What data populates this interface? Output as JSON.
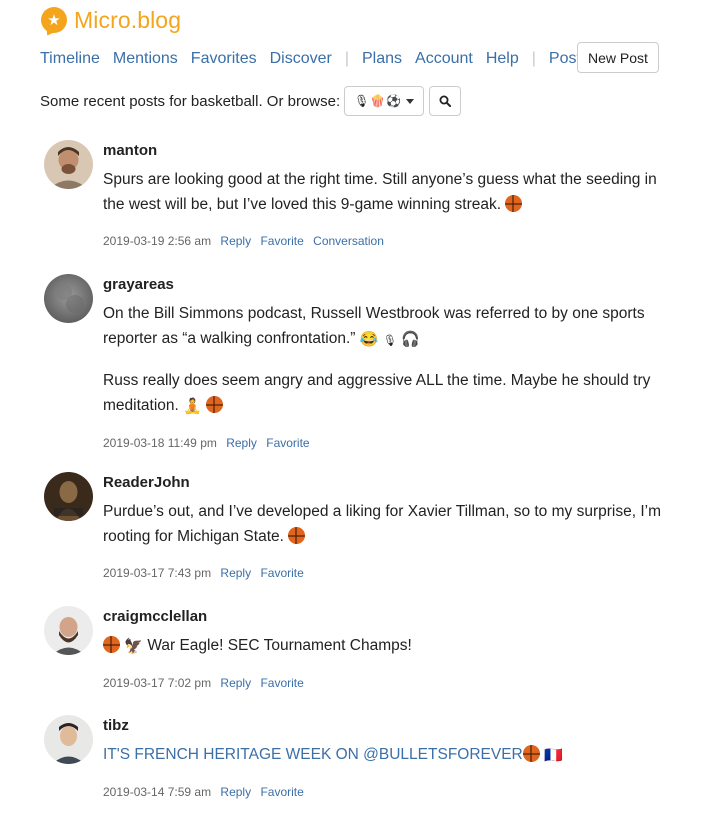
{
  "app": {
    "name": "Micro.blog"
  },
  "nav": {
    "items": [
      "Timeline",
      "Mentions",
      "Favorites",
      "Discover",
      "Plans",
      "Account",
      "Help",
      "Posts"
    ],
    "new_post": "New Post"
  },
  "browse": {
    "text": "Some recent posts for basketball. Or browse:",
    "dropdown_emojis": [
      "🎙",
      "🍿",
      "⚽"
    ]
  },
  "posts": [
    {
      "username": "manton",
      "paragraphs": [
        "Spurs are looking good at the right time. Still anyone’s guess what the seeding in the west will be, but I’ve loved this 9-game winning streak."
      ],
      "date": "2019-03-19 2:56 am",
      "actions": [
        "Reply",
        "Favorite",
        "Conversation"
      ]
    },
    {
      "username": "grayareas",
      "paragraphs": [
        "On the Bill Simmons podcast, Russell Westbrook was referred to by one sports reporter as “a walking confrontation.”",
        "Russ really does seem angry and aggressive ALL the time. Maybe he should try meditation."
      ],
      "date": "2019-03-18 11:49 pm",
      "actions": [
        "Reply",
        "Favorite"
      ]
    },
    {
      "username": "ReaderJohn",
      "paragraphs": [
        "Purdue’s out, and I’ve developed a liking for Xavier Tillman, so to my surprise, I’m rooting for Michigan State."
      ],
      "date": "2019-03-17 7:43 pm",
      "actions": [
        "Reply",
        "Favorite"
      ]
    },
    {
      "username": "craigmcclellan",
      "paragraphs": [
        "War Eagle! SEC Tournament Champs!"
      ],
      "date": "2019-03-17 7:02 pm",
      "actions": [
        "Reply",
        "Favorite"
      ]
    },
    {
      "username": "tibz",
      "paragraphs": [
        "IT'S FRENCH HERITAGE WEEK ON @BULLETSFOREVER"
      ],
      "date": "2019-03-14 7:59 am",
      "actions": [
        "Reply",
        "Favorite"
      ]
    }
  ],
  "emojis": {
    "laugh": "😂",
    "mic": "🎙",
    "headphones": "🎧",
    "meditate": "🧘",
    "eagle": "🦅",
    "flag_fr": "🇫🇷"
  },
  "colors": {
    "brand": "#f4a51c",
    "link": "#3a6fa8"
  }
}
